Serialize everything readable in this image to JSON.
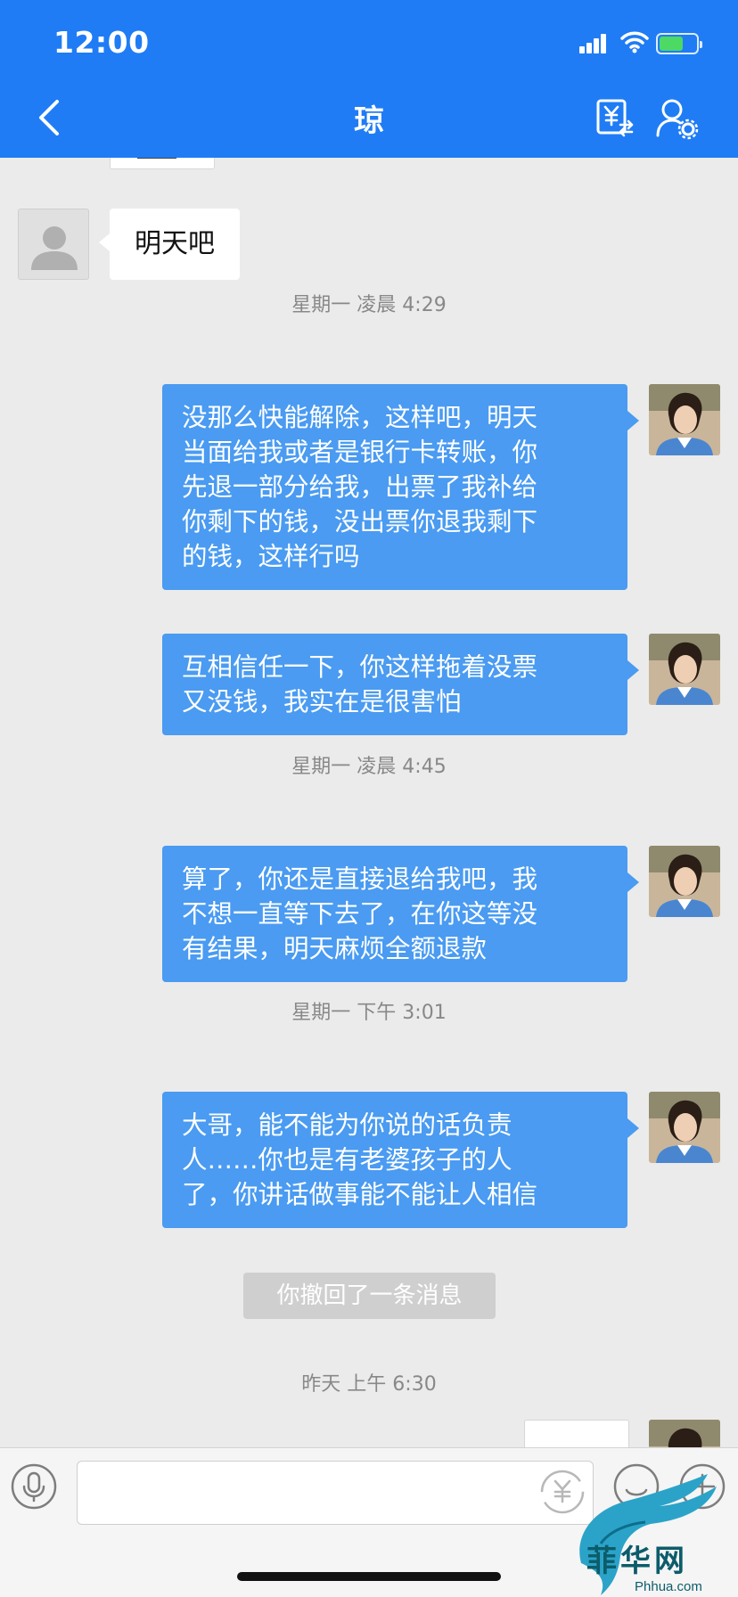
{
  "status_bar": {
    "time": "12:00"
  },
  "header": {
    "title": "琼"
  },
  "colors": {
    "header_bg": "#1f7cf5",
    "bubble_out": "#4a9bf1",
    "bubble_in": "#ffffff",
    "chat_bg": "#ebebeb"
  },
  "messages": [
    {
      "type": "incoming",
      "text": "明天吧"
    },
    {
      "type": "time",
      "text": "星期一 凌晨 4:29"
    },
    {
      "type": "outgoing",
      "lines": [
        "没那么快能解除，这样吧，明天",
        "当面给我或者是银行卡转账，你",
        "先退一部分给我，出票了我补给",
        "你剩下的钱，没出票你退我剩下",
        "的钱，这样行吗"
      ]
    },
    {
      "type": "outgoing",
      "lines": [
        "互相信任一下，你这样拖着没票",
        "又没钱，我实在是很害怕"
      ]
    },
    {
      "type": "time",
      "text": "星期一 凌晨 4:45"
    },
    {
      "type": "outgoing",
      "lines": [
        "算了，你还是直接退给我吧，我",
        "不想一直等下去了，在你这等没",
        "有结果，明天麻烦全额退款"
      ]
    },
    {
      "type": "time",
      "text": "星期一 下午 3:01"
    },
    {
      "type": "outgoing",
      "lines": [
        "大哥，能不能为你说的话负责",
        "人……你也是有老婆孩子的人",
        "了，你讲话做事能不能让人相信"
      ]
    },
    {
      "type": "recall",
      "text": "你撤回了一条消息"
    },
    {
      "type": "time",
      "text": "昨天 上午 6:30"
    }
  ],
  "input": {
    "value": "",
    "placeholder": ""
  },
  "watermark": {
    "text": "菲华网",
    "url": "Phhua.com"
  }
}
